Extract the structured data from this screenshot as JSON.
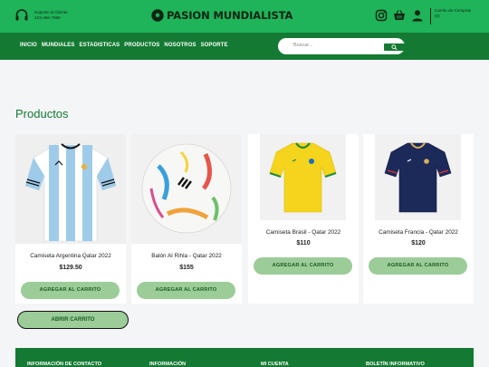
{
  "header": {
    "support_label": "Soporte al Cliente",
    "support_phone": "123-456-7890",
    "brand": "PASION MUNDIALISTA",
    "cart_label": "Carrito de Compras",
    "cart_count": "(0)"
  },
  "nav": {
    "items": [
      "INICIO",
      "MUNDIALES",
      "ESTADISTICAS",
      "PRODUCTOS",
      "NOSOTROS",
      "SOPORTE"
    ]
  },
  "search": {
    "placeholder": "Buscar..."
  },
  "section_title": "Productos",
  "products": [
    {
      "name": "Camiseta Argentina Qatar 2022",
      "price": "$129.50",
      "button": "AGREGAR AL CARRITO"
    },
    {
      "name": "Balón Al Rihla - Qatar 2022",
      "price": "$155",
      "button": "AGREGAR AL CARRITO"
    },
    {
      "name": "Camiseta Brasil - Qatar 2022",
      "price": "$110",
      "button": "AGREGAR AL CARRITO"
    },
    {
      "name": "Camiseta Francia - Qatar 2022",
      "price": "$120",
      "button": "AGREGAR AL CARRITO"
    }
  ],
  "open_cart": "ABRIR CARRITO",
  "footer": {
    "columns": [
      "INFORMACIÓN DE CONTACTO",
      "INFORMACIÓN",
      "MI CUENTA",
      "BOLETÍN INFORMATIVO"
    ]
  },
  "colors": {
    "topbar": "#1fb35a",
    "nav": "#147a33",
    "button": "#9ccc98"
  }
}
